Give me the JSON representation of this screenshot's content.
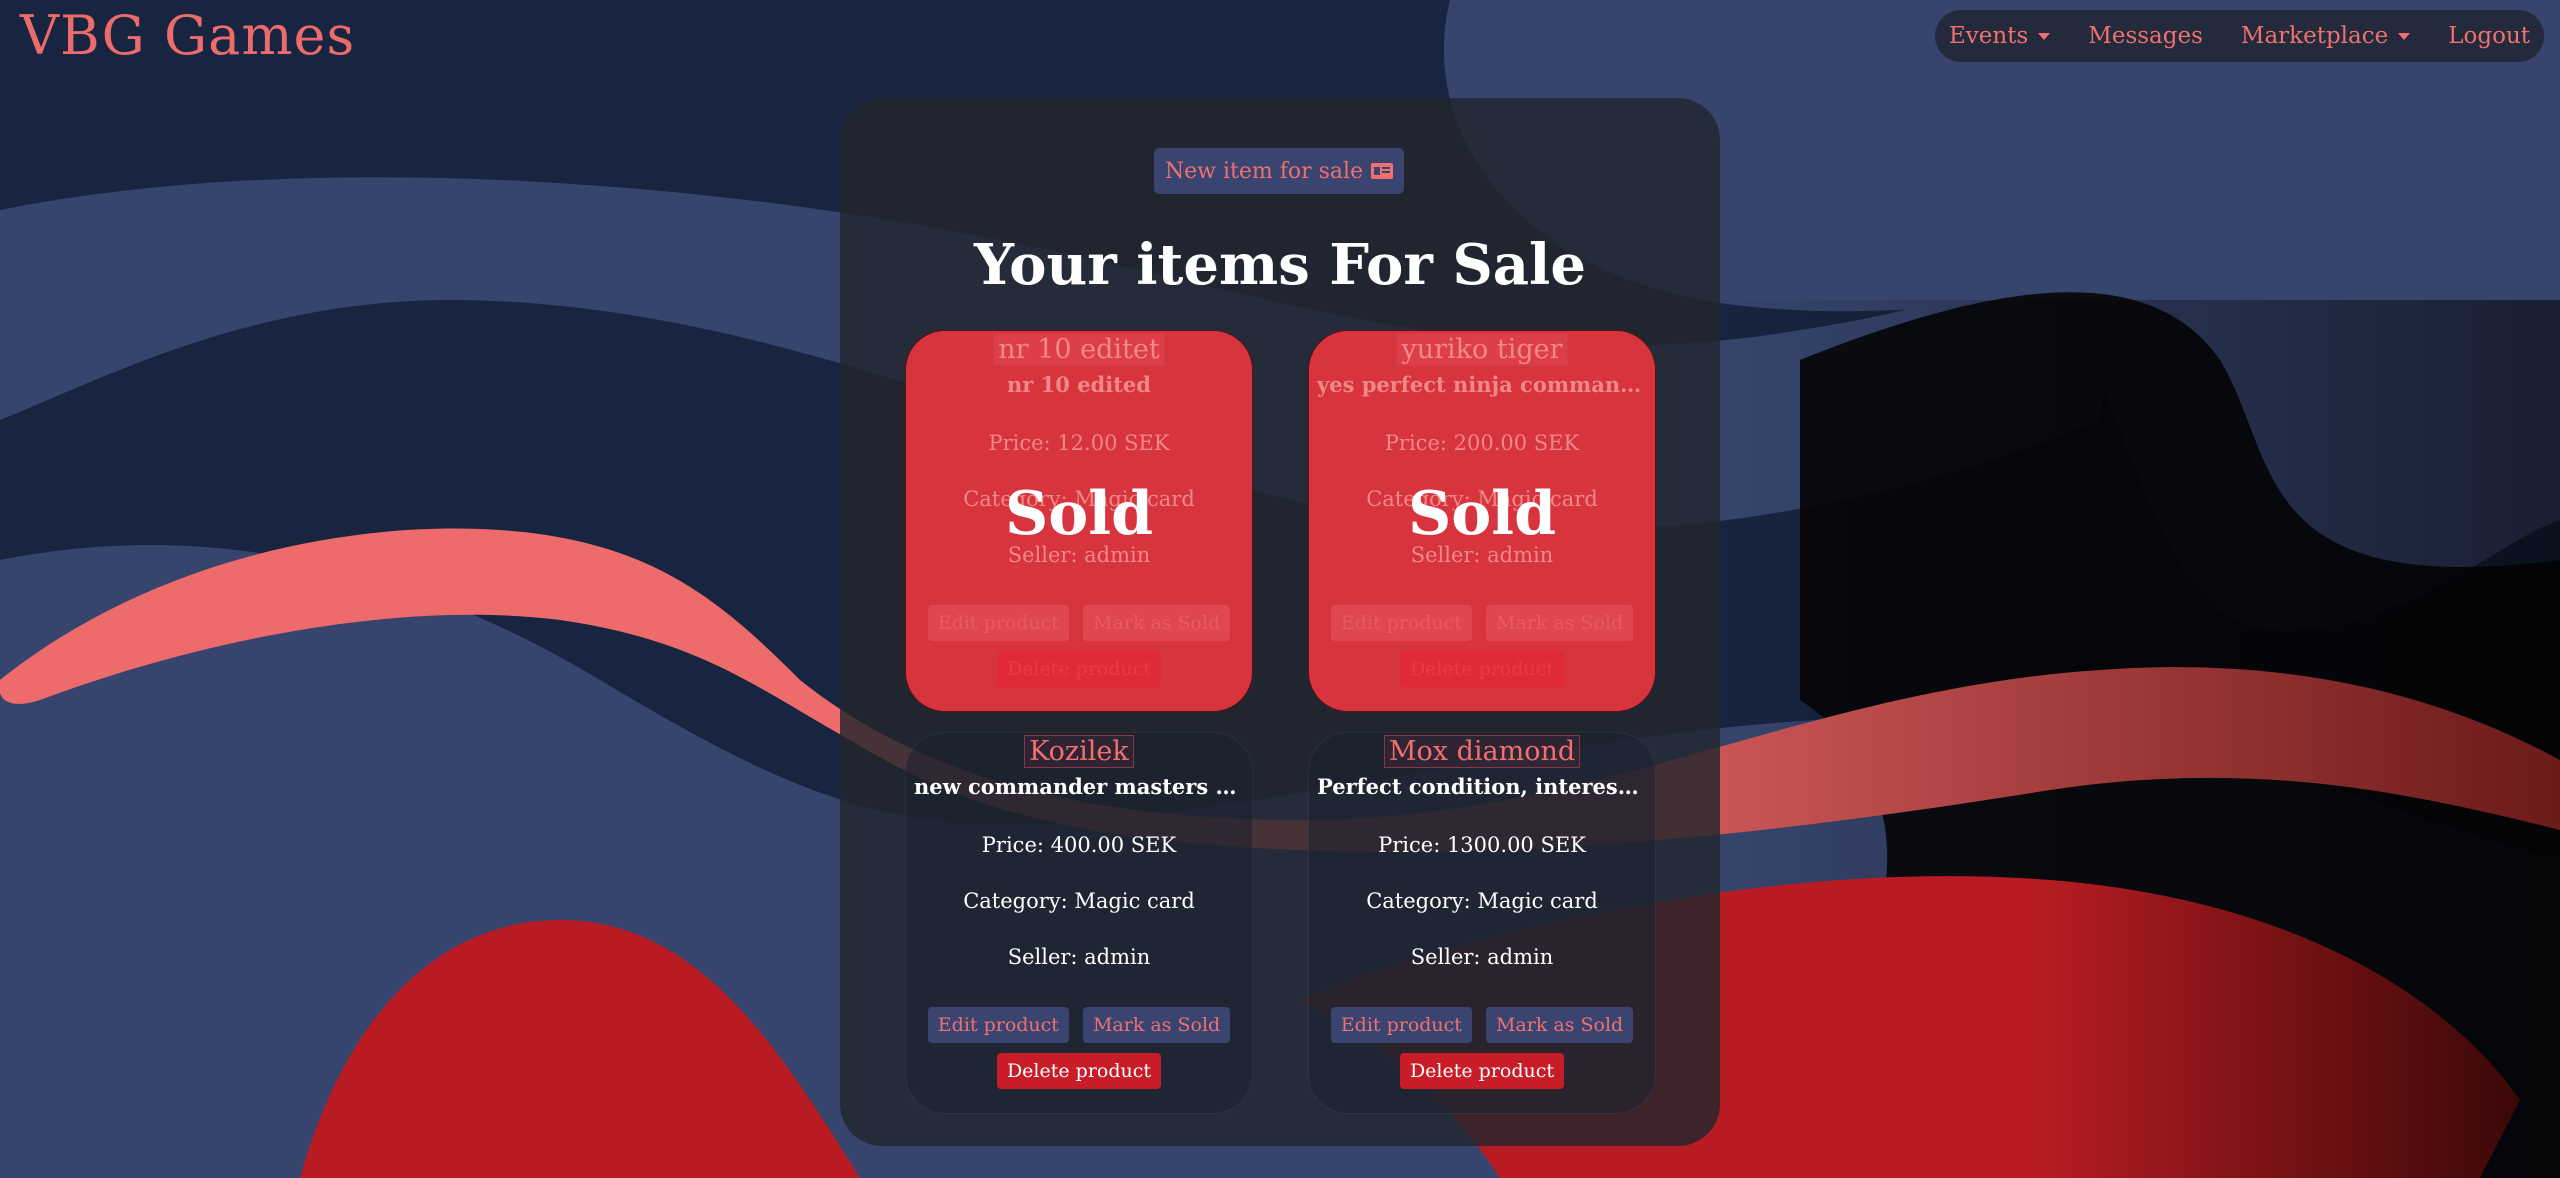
{
  "navbar": {
    "brand": "VBG Games",
    "links": [
      {
        "label": "Events",
        "dropdown": true
      },
      {
        "label": "Messages",
        "dropdown": false
      },
      {
        "label": "Marketplace",
        "dropdown": true
      },
      {
        "label": "Logout",
        "dropdown": false
      }
    ]
  },
  "main": {
    "new_item_button": "New item for sale",
    "title": "Your items For Sale",
    "sold_label": "Sold",
    "products": [
      {
        "name": "nr 10 editet",
        "description": "nr 10 edited",
        "price": "Price: 12.00 SEK",
        "category": "Category: Magic card",
        "seller": "Seller: admin",
        "status": "sold",
        "edit_label": "Edit product",
        "mark_label": "Mark as Sold",
        "delete_label": "Delete product"
      },
      {
        "name": "yuriko tiger",
        "description": "yes perfect ninja commander",
        "price": "Price: 200.00 SEK",
        "category": "Category: Magic card",
        "seller": "Seller: admin",
        "status": "sold",
        "edit_label": "Edit product",
        "mark_label": "Mark as Sold",
        "delete_label": "Delete product"
      },
      {
        "name": "Kozilek",
        "description": "new commander masters Kozilek",
        "price": "Price: 400.00 SEK",
        "category": "Category: Magic card",
        "seller": "Seller: admin",
        "status": "available",
        "edit_label": "Edit product",
        "mark_label": "Mark as Sold",
        "delete_label": "Delete product"
      },
      {
        "name": "Mox diamond",
        "description": "Perfect condition, interested?",
        "price": "Price: 1300.00 SEK",
        "category": "Category: Magic card",
        "seller": "Seller: admin",
        "status": "available",
        "edit_label": "Edit product",
        "mark_label": "Mark as Sold",
        "delete_label": "Delete product"
      }
    ]
  },
  "colors": {
    "background": "#172540",
    "accent": "#f07070",
    "sold_card": "#d7343e",
    "button": "#3a4470",
    "danger": "#c81c28"
  },
  "icons": {
    "new_item": "id-card-icon"
  }
}
